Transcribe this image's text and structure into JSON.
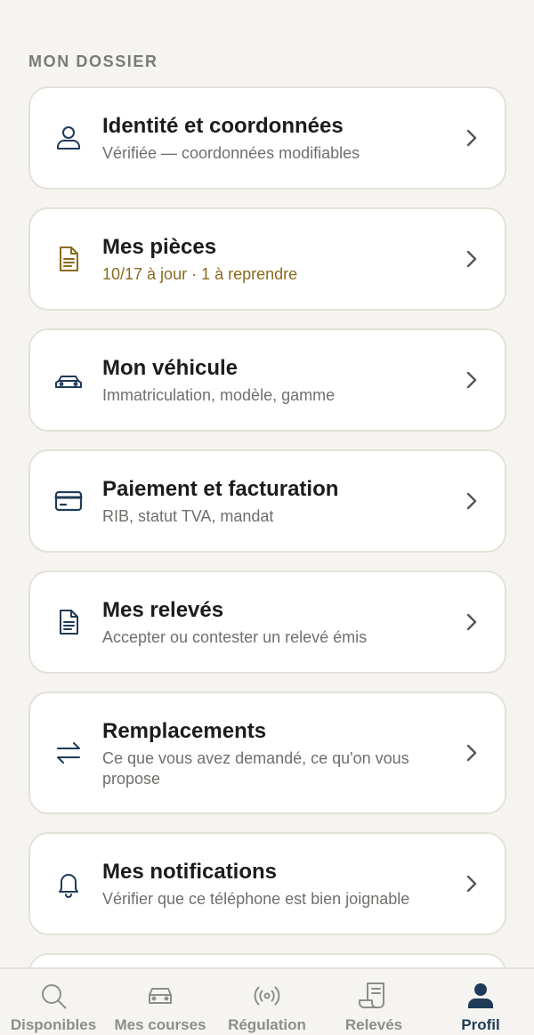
{
  "section": {
    "title": "MON DOSSIER"
  },
  "cards": [
    {
      "title": "Identité et coordonnées",
      "subtitle": "Vérifiée — coordonnées modifiables",
      "icon": "user-icon"
    },
    {
      "title": "Mes pièces",
      "subtitle": "10/17 à jour · 1 à reprendre",
      "icon": "document-icon",
      "subtitle_color": "#8a6a1e",
      "icon_color": "#8a6a1e"
    },
    {
      "title": "Mon véhicule",
      "subtitle": "Immatriculation, modèle, gamme",
      "icon": "car-icon"
    },
    {
      "title": "Paiement et facturation",
      "subtitle": "RIB, statut TVA, mandat",
      "icon": "credit-card-icon"
    },
    {
      "title": "Mes relevés",
      "subtitle": "Accepter ou contester un relevé émis",
      "icon": "receipt-doc-icon"
    },
    {
      "title": "Remplacements",
      "subtitle": "Ce que vous avez demandé, ce qu'on vous propose",
      "icon": "swap-arrows-icon"
    },
    {
      "title": "Mes notifications",
      "subtitle": "Vérifier que ce téléphone est bien joignable",
      "icon": "bell-icon"
    }
  ],
  "tabs": [
    {
      "label": "Disponibles",
      "icon": "search-icon",
      "active": false
    },
    {
      "label": "Mes courses",
      "icon": "car-icon",
      "active": false
    },
    {
      "label": "Régulation",
      "icon": "broadcast-icon",
      "active": false
    },
    {
      "label": "Relevés",
      "icon": "receipt-icon",
      "active": false
    },
    {
      "label": "Profil",
      "icon": "profile-icon",
      "active": true
    }
  ],
  "colors": {
    "background": "#f5f4f1",
    "card_border": "#e4e1d8",
    "icon_navy": "#1f3b57",
    "accent_gold": "#8a6a1e",
    "inactive_tab": "#8d8d89"
  }
}
